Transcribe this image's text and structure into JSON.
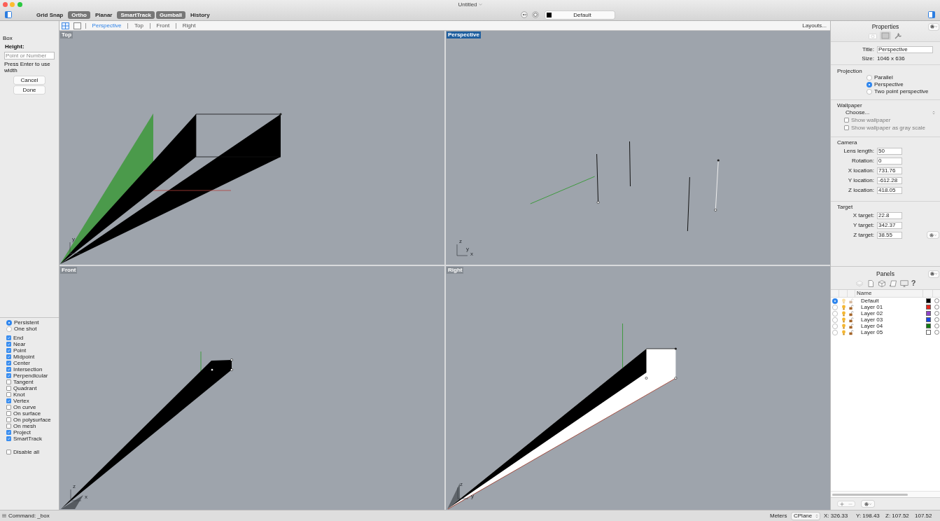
{
  "window": {
    "title": "Untitled"
  },
  "toolbar": {
    "modes": [
      {
        "label": "Grid Snap",
        "on": false
      },
      {
        "label": "Ortho",
        "on": true
      },
      {
        "label": "Planar",
        "on": false
      },
      {
        "label": "SmartTrack",
        "on": true
      },
      {
        "label": "Gumball",
        "on": true
      },
      {
        "label": "History",
        "on": false
      }
    ],
    "layer": {
      "name": "Default",
      "color": "#000000"
    }
  },
  "viewport_tabs": {
    "tabs": [
      {
        "label": "Perspective",
        "selected": true
      },
      {
        "label": "Top",
        "selected": false
      },
      {
        "label": "Front",
        "selected": false
      },
      {
        "label": "Right",
        "selected": false
      }
    ],
    "layouts": "Layouts..."
  },
  "command_panel": {
    "title": "Box",
    "prompt": "Height:",
    "input": {
      "placeholder": "Point or Number"
    },
    "hint": "Press Enter to use width",
    "buttons": [
      "Cancel",
      "Done"
    ]
  },
  "osnap": {
    "modes": [
      {
        "label": "Persistent",
        "selected": true
      },
      {
        "label": "One shot",
        "selected": false
      }
    ],
    "snaps": [
      {
        "label": "End",
        "checked": true
      },
      {
        "label": "Near",
        "checked": true
      },
      {
        "label": "Point",
        "checked": true
      },
      {
        "label": "Midpoint",
        "checked": true
      },
      {
        "label": "Center",
        "checked": true
      },
      {
        "label": "Intersection",
        "checked": true
      },
      {
        "label": "Perpendicular",
        "checked": true
      },
      {
        "label": "Tangent",
        "checked": false
      },
      {
        "label": "Quadrant",
        "checked": false
      },
      {
        "label": "Knot",
        "checked": false
      },
      {
        "label": "Vertex",
        "checked": true
      },
      {
        "label": "On curve",
        "checked": false
      },
      {
        "label": "On surface",
        "checked": false
      },
      {
        "label": "On polysurface",
        "checked": false
      },
      {
        "label": "On mesh",
        "checked": false
      },
      {
        "label": "Project",
        "checked": true
      },
      {
        "label": "SmartTrack",
        "checked": true
      }
    ],
    "disable_all": {
      "label": "Disable all",
      "checked": false
    }
  },
  "viewports": [
    {
      "label": "Top",
      "kind": "top",
      "active": false,
      "axis_labels": [
        "y"
      ]
    },
    {
      "label": "Perspective",
      "kind": "perspective",
      "active": true,
      "axis_labels": [
        "z",
        "y",
        "x"
      ]
    },
    {
      "label": "Front",
      "kind": "front",
      "active": false,
      "axis_labels": [
        "z",
        "x"
      ]
    },
    {
      "label": "Right",
      "kind": "right",
      "active": false,
      "axis_labels": [
        "z",
        "y"
      ]
    }
  ],
  "properties": {
    "title": "Properties",
    "tabs": [
      {
        "selected": false
      },
      {
        "selected": true
      },
      {
        "selected": false
      }
    ],
    "view_title": {
      "label": "Title:",
      "value": "Perspective"
    },
    "size": {
      "label": "Size:",
      "value": "1046 x 636"
    },
    "projection": {
      "heading": "Projection",
      "options": [
        {
          "label": "Parallel",
          "selected": false
        },
        {
          "label": "Perspective",
          "selected": true
        },
        {
          "label": "Two point perspective",
          "selected": false
        }
      ]
    },
    "wallpaper": {
      "heading": "Wallpaper",
      "choice": "Choose...",
      "options": [
        {
          "label": "Show wallpaper",
          "checked": false,
          "disabled": true
        },
        {
          "label": "Show wallpaper as gray scale",
          "checked": false,
          "disabled": true
        }
      ]
    },
    "camera": {
      "heading": "Camera",
      "fields": [
        {
          "label": "Lens length:",
          "value": "50"
        },
        {
          "label": "Rotation:",
          "value": "0"
        },
        {
          "label": "X location:",
          "value": "731.76"
        },
        {
          "label": "Y location:",
          "value": "-612.28"
        },
        {
          "label": "Z location:",
          "value": "418.05"
        }
      ]
    },
    "target": {
      "heading": "Target",
      "fields": [
        {
          "label": "X target:",
          "value": "22.8"
        },
        {
          "label": "Y target:",
          "value": "342.37"
        },
        {
          "label": "Z target:",
          "value": "38.55"
        }
      ]
    }
  },
  "panels": {
    "title": "Panels",
    "help": "?",
    "columns": [
      "Name"
    ],
    "layers": [
      {
        "name": "Default",
        "current": true,
        "color": "#000000"
      },
      {
        "name": "Layer 01",
        "current": false,
        "color": "#e8261e"
      },
      {
        "name": "Layer 02",
        "current": false,
        "color": "#8f44c8"
      },
      {
        "name": "Layer 03",
        "current": false,
        "color": "#1446e8"
      },
      {
        "name": "Layer 04",
        "current": false,
        "color": "#127a12"
      },
      {
        "name": "Layer 05",
        "current": false,
        "color": "#ffffff"
      }
    ]
  },
  "status_bar": {
    "command": "Command: _box",
    "units": "Meters",
    "cplane": "CPlane",
    "x": "X: 326.33",
    "y": "Y: 198.43",
    "z": "Z: 107.52",
    "distance": "107.52"
  }
}
